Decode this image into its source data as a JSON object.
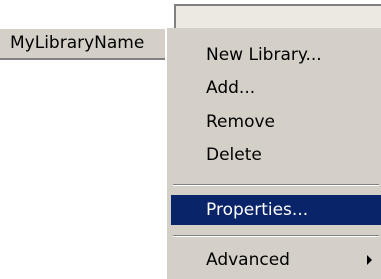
{
  "library_tab": {
    "label": "MyLibraryName"
  },
  "context_menu": {
    "items": [
      {
        "label": "New Library..."
      },
      {
        "label": "Add..."
      },
      {
        "label": "Remove"
      },
      {
        "label": "Delete"
      },
      {
        "label": "Properties...",
        "selected": true
      },
      {
        "label": "Advanced",
        "has_submenu": true
      }
    ]
  },
  "colors": {
    "menu_background": "#d4d0c8",
    "selection_background": "#0a246a",
    "selection_text": "#ffffff"
  }
}
